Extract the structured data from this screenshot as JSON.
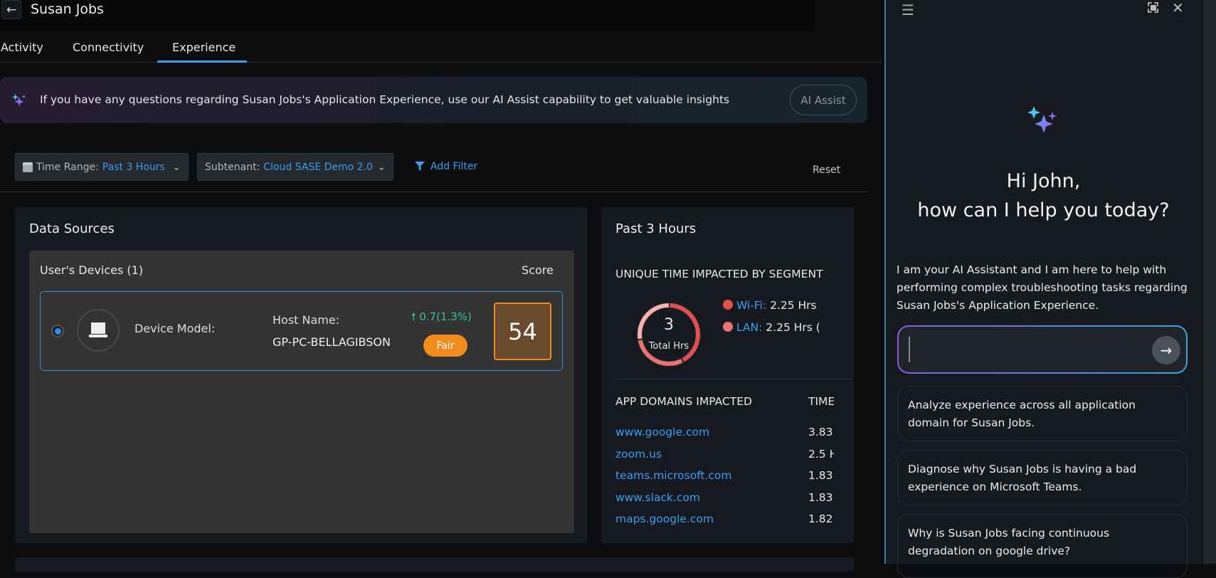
{
  "header": {
    "title": "Susan Jobs",
    "back_icon": "arrow-left-icon"
  },
  "tabs": [
    {
      "label": "Activity"
    },
    {
      "label": "Connectivity"
    },
    {
      "label": "Experience",
      "active": true
    }
  ],
  "banner": {
    "text": "If you have any questions regarding Susan Jobs's Application Experience, use our AI Assist capability to get valuable insights",
    "button": "AI Assist"
  },
  "filters": {
    "time_label": "Time Range:",
    "time_value": "Past 3 Hours",
    "subtenant_label": "Subtenant:",
    "subtenant_value": "Cloud SASE Demo 2.0",
    "add_filter": "Add Filter",
    "reset": "Reset"
  },
  "data_sources": {
    "title": "Data Sources",
    "devices_label": "User's Devices (1)",
    "score_label": "Score",
    "device": {
      "model_label": "Device Model:",
      "host_label": "Host Name:",
      "host_value": "GP-PC-BELLAGIBSON",
      "delta": "0.7",
      "delta_pct": "(1.3%)",
      "rating": "Fair",
      "score": "54"
    }
  },
  "past": {
    "title": "Past 3 Hours",
    "segment_title": "UNIQUE TIME IMPACTED BY SEGMENT",
    "total": "3",
    "total_label": "Total Hrs",
    "segments": [
      {
        "name": "Wi-Fi:",
        "value": "2.25 Hrs",
        "color": "#e05050",
        "fraction": 0.42
      },
      {
        "name": "LAN:",
        "value": "2.25 Hrs (",
        "color": "#e87474",
        "fraction": 0.3
      }
    ],
    "remainder_color": "#f3b3b3",
    "domains_header": "APP DOMAINS IMPACTED",
    "time_header": "TIME",
    "domains": [
      {
        "name": "www.google.com",
        "time": "3.83"
      },
      {
        "name": "zoom.us",
        "time": "2.5 H"
      },
      {
        "name": "teams.microsoft.com",
        "time": "1.83"
      },
      {
        "name": "www.slack.com",
        "time": "1.83"
      },
      {
        "name": "maps.google.com",
        "time": "1.82"
      }
    ]
  },
  "assistant": {
    "greeting_1": "Hi John,",
    "greeting_2": "how can I help you today?",
    "intro": "I am your AI Assistant and I am here to help with performing complex troubleshooting tasks regarding Susan Jobs's Application Experience.",
    "input_placeholder": "",
    "suggestions": [
      "Analyze experience across all application domain for Susan Jobs.",
      "Diagnose why Susan Jobs is having a bad experience on Microsoft Teams.",
      "Why is Susan Jobs facing continuous degradation on google drive?"
    ]
  }
}
